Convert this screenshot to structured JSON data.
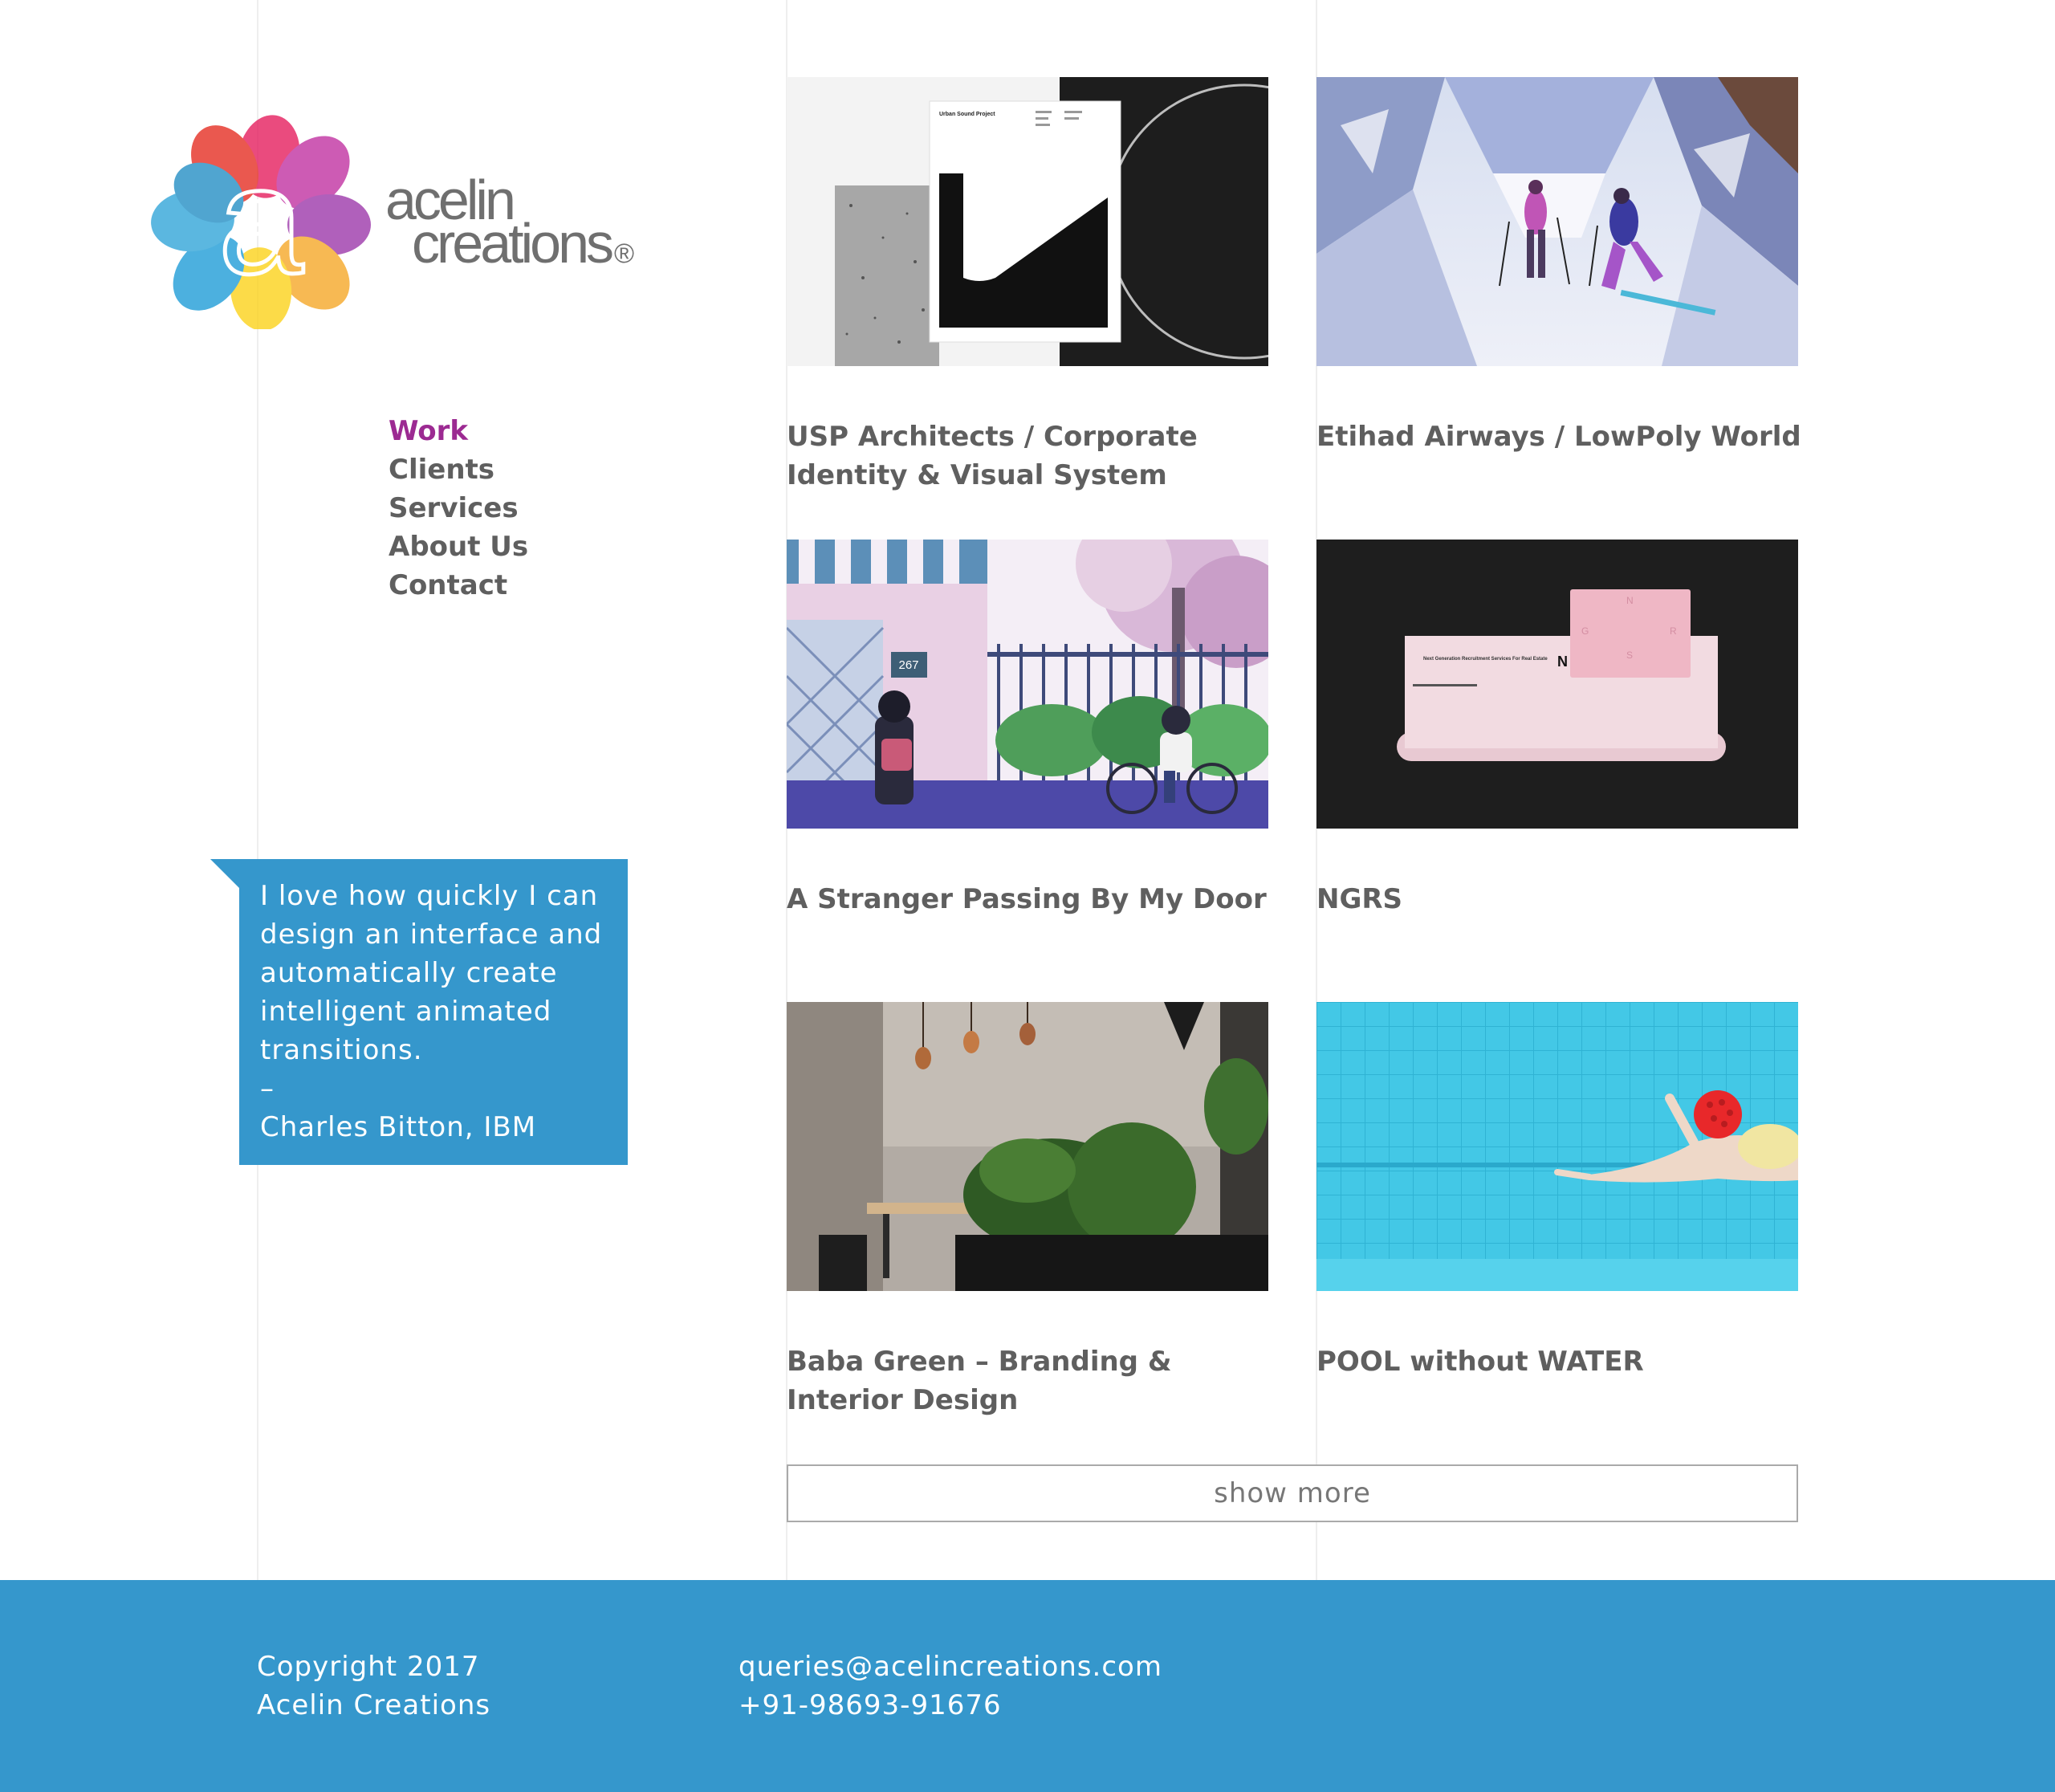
{
  "brand": {
    "name_line1": "acelin",
    "name_line2": "creations",
    "registered": "®",
    "logo_letter": "a"
  },
  "nav": {
    "items": [
      {
        "label": "Work",
        "active": true
      },
      {
        "label": "Clients",
        "active": false
      },
      {
        "label": "Services",
        "active": false
      },
      {
        "label": "About Us",
        "active": false
      },
      {
        "label": "Contact",
        "active": false
      }
    ]
  },
  "testimonial": {
    "lines": [
      "I love how quickly I can",
      "design an interface and",
      "automatically create",
      "intelligent animated",
      "transitions."
    ],
    "dash": "–",
    "author": "Charles Bitton, IBM"
  },
  "projects": [
    {
      "title": "USP Architects / Corporate Identity & Visual System",
      "image": "usp-architects-image"
    },
    {
      "title": "Etihad Airways / LowPoly World",
      "image": "etihad-lowpoly-image"
    },
    {
      "title": "A Stranger Passing By My Door",
      "image": "stranger-illustration-image"
    },
    {
      "title": "NGRS",
      "image": "ngrs-stationery-image"
    },
    {
      "title": "Baba Green – Branding & Interior Design",
      "image": "baba-green-interior-image"
    },
    {
      "title": "POOL without WATER",
      "image": "pool-swimmer-image"
    }
  ],
  "artwork_text": {
    "usp_doc_title": "Urban Sound Project",
    "house_number": "267",
    "ngrs_card": "Next Generation\nRecruitment Services\nFor Real Estate",
    "ngrs_letter": "N"
  },
  "show_more": {
    "label": "show more"
  },
  "footer": {
    "copyright_line1": "Copyright 2017",
    "copyright_line2": "Acelin Creations",
    "email": "queries@acelincreations.com",
    "phone": "+91-98693-91676"
  },
  "colors": {
    "accent_purple": "#9c2a92",
    "accent_blue": "#3597cc",
    "text_gray": "#5f5f5f"
  }
}
